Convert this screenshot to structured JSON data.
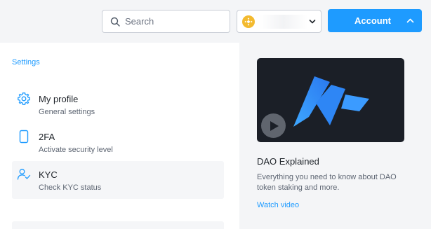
{
  "header": {
    "search": {
      "placeholder": "Search",
      "value": "",
      "icon": "search-icon"
    },
    "network_selector": {
      "icon": "bnb-icon",
      "value": "",
      "chevron": "chevron-down-icon"
    },
    "account_button": {
      "label": "Account",
      "chevron": "chevron-up-icon"
    }
  },
  "settings": {
    "breadcrumb": "Settings",
    "items": [
      {
        "title": "My profile",
        "subtitle": "General settings",
        "icon": "gear-icon",
        "active": false
      },
      {
        "title": "2FA",
        "subtitle": "Activate security level",
        "icon": "phone-icon",
        "active": false
      },
      {
        "title": "KYC",
        "subtitle": "Check KYC status",
        "icon": "user-check-icon",
        "active": true
      }
    ]
  },
  "promo": {
    "title": "DAO Explained",
    "description": "Everything you need to know about DAO token staking and more.",
    "link": "Watch video"
  },
  "colors": {
    "accent": "#1e9bff",
    "bnb": "#f3ba2f",
    "video_bg": "#1b1f27",
    "logo_blue": "#2f8dff"
  }
}
